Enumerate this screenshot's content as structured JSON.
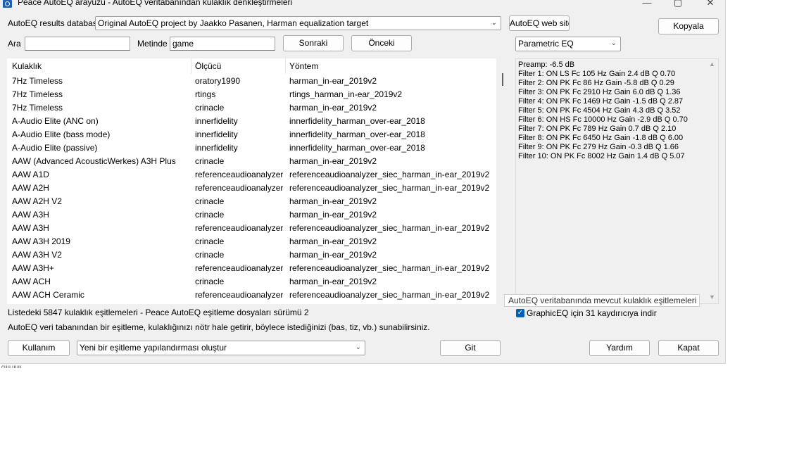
{
  "window": {
    "title": "Peace AutoEQ arayüzü - AutoEQ veritabanından kulaklık denkleştirmeleri"
  },
  "top": {
    "db_label": "AutoEQ results database",
    "db_selected": "Original AutoEQ project by Jaakko Pasanen, Harman equalization target",
    "web_button": "AutoEQ web sites",
    "copy_button": "Kopyala",
    "search_label": "Ara",
    "search_value": "",
    "in_label": "Metinde",
    "in_value": "game",
    "next_button": "Sonraki",
    "prev_button": "Önceki",
    "eq_type_selected": "Parametric EQ"
  },
  "table": {
    "headers": [
      "Kulaklık",
      "Ölçücü",
      "Yöntem"
    ],
    "rows": [
      [
        "7Hz Timeless",
        "oratory1990",
        "harman_in-ear_2019v2"
      ],
      [
        "7Hz Timeless",
        "rtings",
        "rtings_harman_in-ear_2019v2"
      ],
      [
        "7Hz Timeless",
        "crinacle",
        "harman_in-ear_2019v2"
      ],
      [
        "A-Audio Elite (ANC on)",
        "innerfidelity",
        "innerfidelity_harman_over-ear_2018"
      ],
      [
        "A-Audio Elite (bass mode)",
        "innerfidelity",
        "innerfidelity_harman_over-ear_2018"
      ],
      [
        "A-Audio Elite (passive)",
        "innerfidelity",
        "innerfidelity_harman_over-ear_2018"
      ],
      [
        "AAW (Advanced AcousticWerkes) A3H Plus",
        "crinacle",
        "harman_in-ear_2019v2"
      ],
      [
        "AAW A1D",
        "referenceaudioanalyzer",
        "referenceaudioanalyzer_siec_harman_in-ear_2019v2"
      ],
      [
        "AAW A2H",
        "referenceaudioanalyzer",
        "referenceaudioanalyzer_siec_harman_in-ear_2019v2"
      ],
      [
        "AAW A2H V2",
        "crinacle",
        "harman_in-ear_2019v2"
      ],
      [
        "AAW A3H",
        "crinacle",
        "harman_in-ear_2019v2"
      ],
      [
        "AAW A3H",
        "referenceaudioanalyzer",
        "referenceaudioanalyzer_siec_harman_in-ear_2019v2"
      ],
      [
        "AAW A3H 2019",
        "crinacle",
        "harman_in-ear_2019v2"
      ],
      [
        "AAW A3H V2",
        "crinacle",
        "harman_in-ear_2019v2"
      ],
      [
        "AAW A3H+",
        "referenceaudioanalyzer",
        "referenceaudioanalyzer_siec_harman_in-ear_2019v2"
      ],
      [
        "AAW ACH",
        "crinacle",
        "harman_in-ear_2019v2"
      ],
      [
        "AAW ACH Ceramic",
        "referenceaudioanalyzer",
        "referenceaudioanalyzer_siec_harman_in-ear_2019v2"
      ]
    ]
  },
  "eq_text": [
    "Preamp: -6.5 dB",
    "Filter 1: ON LS Fc 105 Hz Gain 2.4 dB Q 0.70",
    "Filter 2: ON PK Fc 86 Hz Gain -5.8 dB Q 0.29",
    "Filter 3: ON PK Fc 2910 Hz Gain 6.0 dB Q 1.36",
    "Filter 4: ON PK Fc 1469 Hz Gain -1.5 dB Q 2.87",
    "Filter 5: ON PK Fc 4504 Hz Gain 4.3 dB Q 3.52",
    "Filter 6: ON HS Fc 10000 Hz Gain -2.9 dB Q 0.70",
    "Filter 7: ON PK Fc 789 Hz Gain 0.7 dB Q 2.10",
    "Filter 8: ON PK Fc 6450 Hz Gain -1.8 dB Q 6.00",
    "Filter 9: ON PK Fc 279 Hz Gain -0.3 dB Q 1.66",
    "Filter 10: ON PK Fc 8002 Hz Gain 1.4 dB Q 5.07"
  ],
  "tooltip": "AutoEQ veritabanında mevcut kulaklık eşitlemeleri",
  "graphiceq_checkbox": "GraphicEQ için 31 kaydırıcıya indir",
  "status": {
    "count_line": "Listedeki 5847 kulaklık eşitlemeleri - Peace AutoEQ eşitleme dosyaları sürümü 2",
    "info_line": "AutoEQ veri tabanından bir eşitleme, kulaklığınızı nötr hale getirir, böylece istediğinizi (bas, tiz, vb.) sunabilirsiniz."
  },
  "bottom": {
    "use_button": "Kullanım",
    "config_selected": "Yeni bir eşitleme yapılandırması oluştur",
    "go_button": "Git",
    "help_button": "Yardım",
    "close_button": "Kapat"
  },
  "background_fragment": "cuu uuu"
}
